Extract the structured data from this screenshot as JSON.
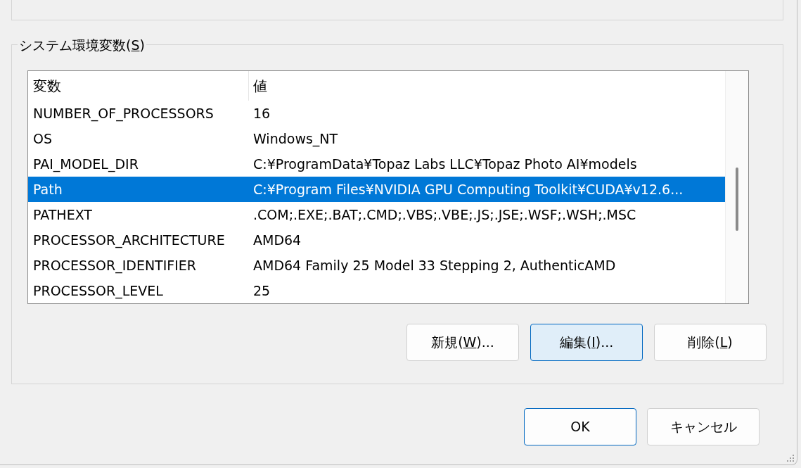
{
  "group": {
    "label_before": "システム環境変数(",
    "access_key": "S",
    "label_after": ")"
  },
  "table": {
    "columns": [
      "変数",
      "値"
    ],
    "rows": [
      {
        "cells": [
          "NUMBER_OF_PROCESSORS",
          "16"
        ],
        "selected": false
      },
      {
        "cells": [
          "OS",
          "Windows_NT"
        ],
        "selected": false
      },
      {
        "cells": [
          "PAI_MODEL_DIR",
          "C:¥ProgramData¥Topaz Labs LLC¥Topaz Photo AI¥models"
        ],
        "selected": false
      },
      {
        "cells": [
          "Path",
          "C:¥Program Files¥NVIDIA GPU Computing Toolkit¥CUDA¥v12.6..."
        ],
        "selected": true
      },
      {
        "cells": [
          "PATHEXT",
          ".COM;.EXE;.BAT;.CMD;.VBS;.VBE;.JS;.JSE;.WSF;.WSH;.MSC"
        ],
        "selected": false
      },
      {
        "cells": [
          "PROCESSOR_ARCHITECTURE",
          "AMD64"
        ],
        "selected": false
      },
      {
        "cells": [
          "PROCESSOR_IDENTIFIER",
          "AMD64 Family 25 Model 33 Stepping 2, AuthenticAMD"
        ],
        "selected": false
      },
      {
        "cells": [
          "PROCESSOR_LEVEL",
          "25"
        ],
        "selected": false
      }
    ]
  },
  "group_buttons": [
    {
      "label_before": "新規(",
      "access_key": "W",
      "label_after": ")...",
      "highlighted": false
    },
    {
      "label_before": "編集(",
      "access_key": "I",
      "label_after": ")...",
      "highlighted": true
    },
    {
      "label_before": "削除(",
      "access_key": "L",
      "label_after": ")",
      "highlighted": false
    }
  ],
  "dialog_buttons": [
    {
      "label": "OK",
      "default": true
    },
    {
      "label": "キャンセル",
      "default": false
    }
  ]
}
